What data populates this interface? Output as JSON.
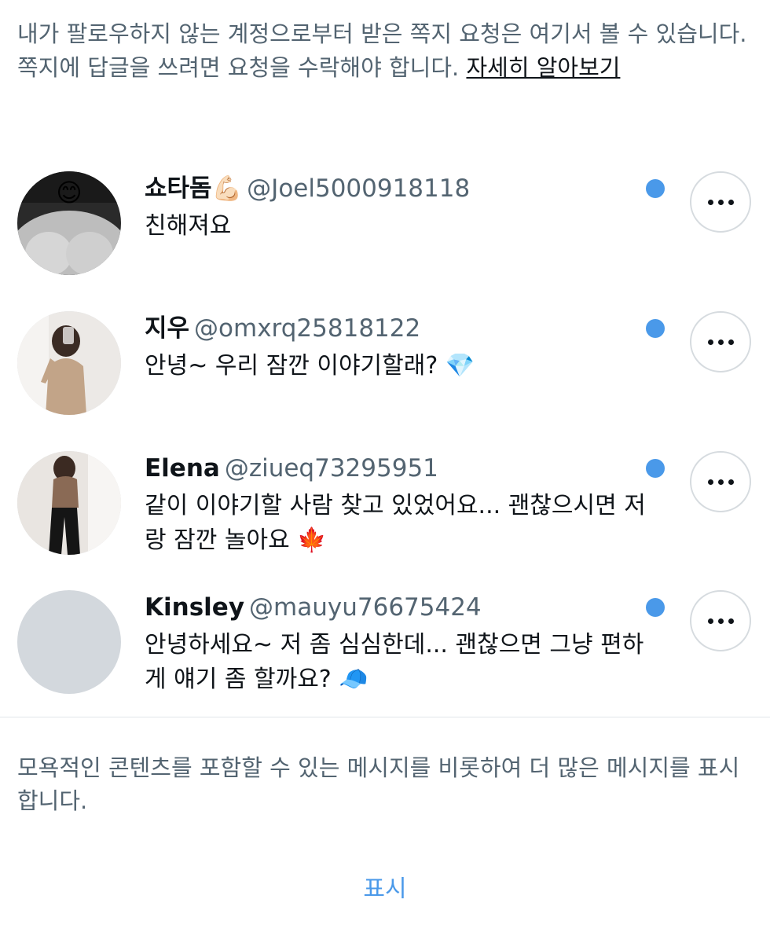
{
  "intro": {
    "text": "내가 팔로우하지 않는 계정으로부터 받은 쪽지 요청은 여기서 볼 수 있습니다. 쪽지에 답글을 쓰려면 요청을 수락해야 합니다. ",
    "link": "자세히 알아보기"
  },
  "requests": [
    {
      "name": "쇼타돔💪🏻",
      "handle": "@Joel5000918118",
      "message": "친해져요",
      "unread": true
    },
    {
      "name": "지우",
      "handle": "@omxrq25818122",
      "message": "안녕~ 우리 잠깐 이야기할래? 💎",
      "unread": true
    },
    {
      "name": "Elena",
      "handle": "@ziueq73295951",
      "message": "같이 이야기할 사람 찾고 있었어요... 괜찮으시면 저랑 잠깐 놀아요 🍁",
      "unread": true
    },
    {
      "name": "Kinsley",
      "handle": "@mauyu76675424",
      "message": "안녕하세요~ 저 좀 심심한데... 괜찮으면 그냥 편하게 얘기 좀 할까요? 🧢",
      "unread": true
    }
  ],
  "footer": {
    "note": "모욕적인 콘텐츠를 포함할 수 있는 메시지를 비롯하여 더 많은 메시지를 표시합니다.",
    "show_label": "표시"
  },
  "colors": {
    "accent": "#4a99e9",
    "secondary_text": "#536471",
    "primary_text": "#0f1419"
  },
  "icons": {
    "more": "more-horizontal-icon",
    "unread": "unread-dot-icon"
  }
}
